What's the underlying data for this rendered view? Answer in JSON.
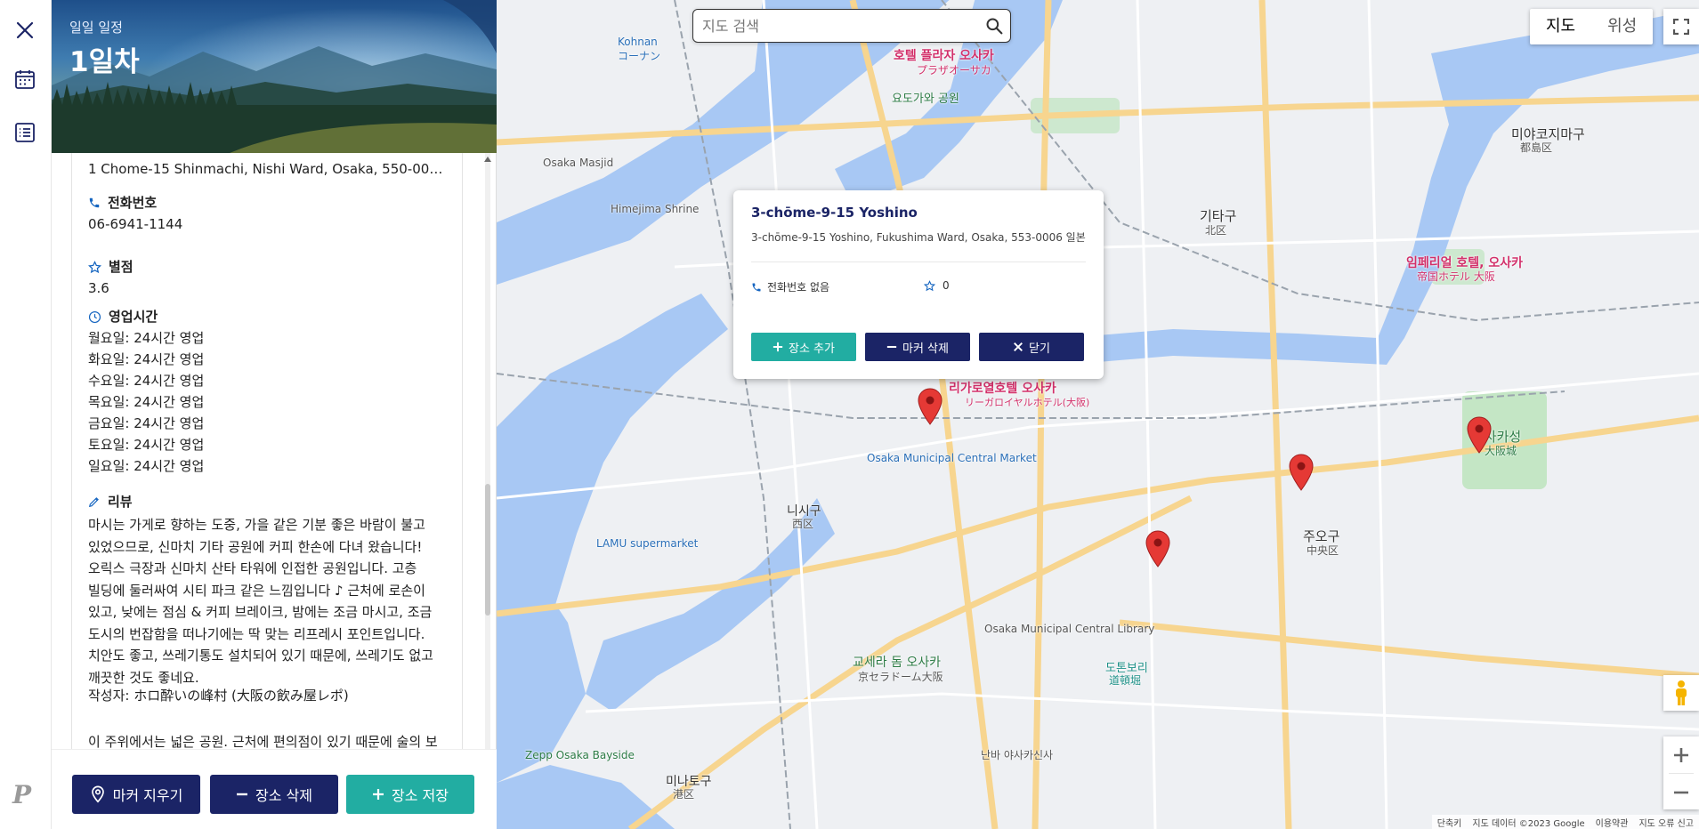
{
  "panel": {
    "header_sub": "일일 일정",
    "header_title": "1일차",
    "address": "1 Chome-15 Shinmachi, Nishi Ward, Osaka, 550-001...",
    "phone_label": "전화번호",
    "phone_value": "06-6941-1144",
    "rating_label": "별점",
    "rating_value": "3.6",
    "hours_label": "영업시간",
    "hours": [
      "월요일: 24시간 영업",
      "화요일: 24시간 영업",
      "수요일: 24시간 영업",
      "목요일: 24시간 영업",
      "금요일: 24시간 영업",
      "토요일: 24시간 영업",
      "일요일: 24시간 영업"
    ],
    "review_label": "리뷰",
    "review_text": "마시는 가게로 향하는 도중, 가을 같은 기분 좋은 바람이 불고 있었으므로, 신마치 기타 공원에 커피 한손에 다녀 왔습니다! 오릭스 극장과 신마치 산타 타워에 인접한 공원입니다. 고층 빌딩에 둘러싸여 시티 파크 같은 느낌입니다 ♪ 근처에 로손이 있고, 낮에는 점심 & 커피 브레이크, 밤에는 조금 마시고, 조금 도시의 번잡함을 떠나기에는 딱 맞는 리프레시 포인트입니다. 치안도 좋고, 쓰레기통도 설치되어 있기 때문에, 쓰레기도 없고 깨끗한 것도 좋네요.",
    "review_author": "작성자: ホロ酔いの峰村 (大阪の飲み屋レポ)",
    "review2_text": "이 주위에서는 넓은 공원. 근처에 편의점이 있기 때문에 술의 보",
    "btn_clear_markers": "마커 지우기",
    "btn_delete_place": "장소 삭제",
    "btn_save_place": "장소 저장"
  },
  "map": {
    "search_placeholder": "지도 검색",
    "type_map": "지도",
    "type_satellite": "위성",
    "attribution": [
      "단축키",
      "지도 데이터 ©2023 Google",
      "이용약관",
      "지도 오류 신고"
    ],
    "labels": {
      "hotel_plaza": "호텔 플라자 오사카",
      "hotel_plaza_jp": "プラザオーサカ",
      "yodogawa_park": "요도가와 공원",
      "kitaku": "기타구",
      "kitaku_jp": "北区",
      "miyakojima": "미야코지마구",
      "miyakojima_jp": "都島区",
      "imperial": "임페리얼 호텔, 오사카",
      "imperial_jp": "帝国ホテル 大阪",
      "riga": "리가로열호텔 오사카",
      "riga_jp": "リーガロイヤルホテル(大阪)",
      "osaka_castle": "오사카성",
      "osaka_castle_jp": "大阪城",
      "chuo": "주오구",
      "chuo_jp": "中央区",
      "nishi": "니시구",
      "nishi_jp": "西区",
      "central_market": "Osaka Municipal Central Market",
      "lamu": "LAMU supermarket",
      "kyocera": "교세라 돔 오사카",
      "kyocera_jp": "京セラドーム大阪",
      "library": "Osaka Municipal Central Library",
      "zepp": "Zepp Osaka Bayside",
      "minato": "미나토구",
      "minato_jp": "港区",
      "dotonbori": "도톤보리",
      "dotonbori_jp": "道頓堀",
      "namba": "난바 야사카신사",
      "kohnan": "Kohnan",
      "kohnan_jp": "コーナン",
      "himejima": "Himejima Shrine",
      "masjid": "Osaka Masjid"
    }
  },
  "popup": {
    "title": "3-chōme-9-15 Yoshino",
    "address": "3-chōme-9-15 Yoshino, Fukushima Ward, Osaka, 553-0006 일본",
    "phone": "전화번호 없음",
    "rating": "0",
    "btn_add": "장소 추가",
    "btn_delete_marker": "마커 삭제",
    "btn_close": "닫기"
  },
  "colors": {
    "navy": "#1b2466",
    "teal": "#22ada2",
    "accent_blue": "#1565c0",
    "marker_red": "#e53935"
  }
}
